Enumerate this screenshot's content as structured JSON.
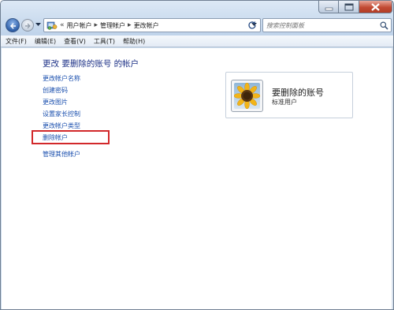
{
  "navigation": {
    "breadcrumbs": [
      "用户帐户",
      "管理帐户",
      "更改帐户"
    ],
    "overflow_marker": "«",
    "search_placeholder": "搜索控制面板",
    "icons": {
      "back": "back-arrow-icon",
      "forward": "forward-arrow-icon",
      "recent": "chevron-down-icon",
      "address": "control-panel-icon",
      "refresh": "refresh-icon",
      "search": "search-icon"
    }
  },
  "menu": {
    "items": [
      "文件(F)",
      "编辑(E)",
      "查看(V)",
      "工具(T)",
      "帮助(H)"
    ]
  },
  "page": {
    "title": "更改 要删除的账号 的帐户",
    "tasks": [
      "更改帐户名称",
      "创建密码",
      "更改图片",
      "设置家长控制",
      "更改帐户类型",
      "删除帐户"
    ],
    "other_link": "管理其他帐户",
    "highlighted_task": "删除帐户"
  },
  "account": {
    "name": "要删除的账号",
    "type": "标准用户",
    "picture": "flower-avatar-icon"
  },
  "colors": {
    "link": "#1a4fae",
    "title": "#1e3287",
    "highlight": "#d2282a",
    "navbar": "#c9daec"
  }
}
